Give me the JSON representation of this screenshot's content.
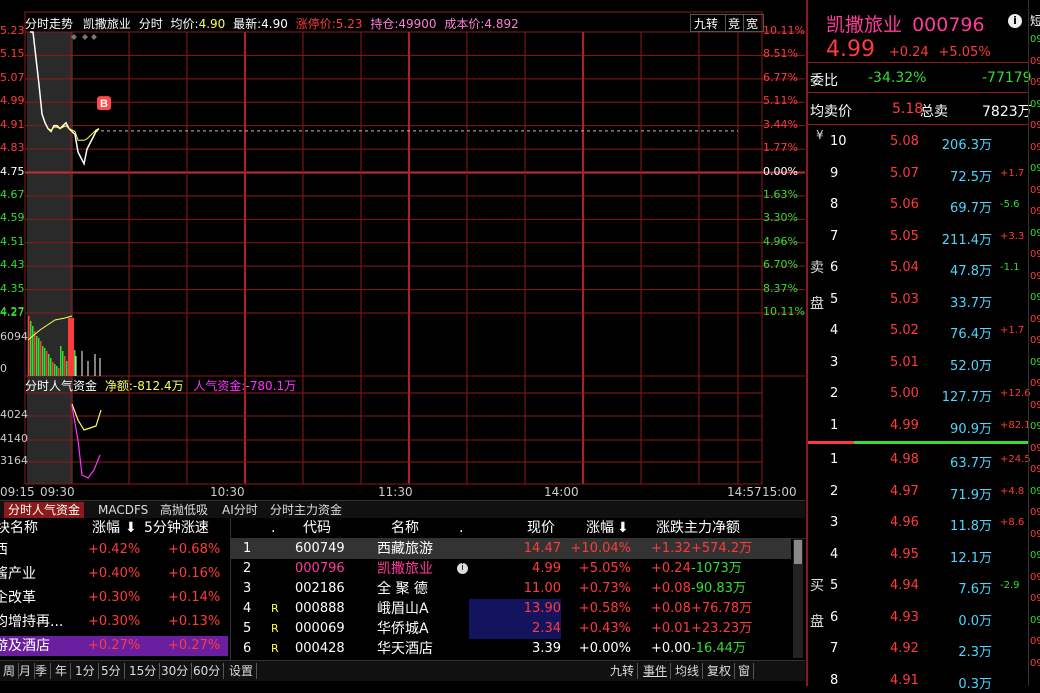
{
  "header": {
    "title": "分时走势",
    "stock_name": "凯撒旅业",
    "mode": "分时",
    "avg_label": "均价:",
    "avg": "4.90",
    "last_label": "最新:",
    "last": "4.90",
    "limit_label": "涨停价:",
    "limit": "5.23",
    "pos_label": "持仓:",
    "pos": "49900",
    "cost_label": "成本价:",
    "cost": "4.892",
    "btn1": "九转",
    "btn2": "竞",
    "btn3": "宽"
  },
  "colors": {
    "grid": "#8b1a1a",
    "up": "#ff3b3b",
    "down": "#33dd33",
    "price_line": "#ffffff",
    "avg_line": "#ffff4d"
  },
  "chart_data": {
    "type": "line",
    "title": "分时走势",
    "x_ticks": [
      "09:15",
      "09:30",
      "10:30",
      "11:30",
      "14:00",
      "14:57",
      "15:00"
    ],
    "price_ticks": [
      "5.23",
      "5.15",
      "5.07",
      "4.99",
      "4.91",
      "4.83",
      "4.75",
      "4.67",
      "4.59",
      "4.51",
      "4.43",
      "4.35",
      "4.27"
    ],
    "pct_ticks": [
      "10.11%",
      "8.51%",
      "6.77%",
      "5.11%",
      "3.44%",
      "1.77%",
      "0.00%",
      "1.63%",
      "3.30%",
      "4.96%",
      "6.70%",
      "8.37%",
      "10.11%"
    ],
    "ylim": [
      4.27,
      5.23
    ],
    "prev_close": 4.75,
    "price_series": [
      {
        "t": 0,
        "v": 5.23
      },
      {
        "t": 1,
        "v": 5.23
      },
      {
        "t": 2,
        "v": 5.14
      },
      {
        "t": 3,
        "v": 5.05
      },
      {
        "t": 4,
        "v": 4.95
      },
      {
        "t": 5,
        "v": 4.92
      },
      {
        "t": 6,
        "v": 4.9
      },
      {
        "t": 7,
        "v": 4.89
      },
      {
        "t": 8,
        "v": 4.91
      },
      {
        "t": 9,
        "v": 4.91
      },
      {
        "t": 10,
        "v": 4.9
      },
      {
        "t": 11,
        "v": 4.91
      },
      {
        "t": 12,
        "v": 4.92
      },
      {
        "t": 13,
        "v": 4.9
      },
      {
        "t": 14,
        "v": 4.89
      },
      {
        "t": 15,
        "v": 4.88
      },
      {
        "t": 16,
        "v": 4.82
      },
      {
        "t": 17,
        "v": 4.8
      },
      {
        "t": 18,
        "v": 4.78
      },
      {
        "t": 19,
        "v": 4.83
      },
      {
        "t": 20,
        "v": 4.85
      },
      {
        "t": 21,
        "v": 4.87
      },
      {
        "t": 22,
        "v": 4.89
      },
      {
        "t": 23,
        "v": 4.9
      }
    ],
    "buy_marker": {
      "label": "B",
      "t": 22
    },
    "cost_line": 4.892,
    "volume_ticks": [
      "4.27",
      "6094",
      "0"
    ],
    "flow_title": "分时人气资金",
    "net_label": "净额:",
    "net": "-812.4万",
    "pop_label": "人气资金:",
    "pop": "-780.1万",
    "flow_ticks": [
      "4024",
      "4140",
      "3164"
    ]
  },
  "tabs": [
    "分时人气资金",
    "MACDFS",
    "高抛低吸",
    "AI分时",
    "分时主力资金"
  ],
  "sector_table": {
    "headers": [
      "块名称",
      "涨幅",
      "5分钟涨速"
    ],
    "rows": [
      {
        "name": "西",
        "chg": "+0.42%",
        "speed": "+0.68%"
      },
      {
        "name": "酱产业",
        "chg": "+0.40%",
        "speed": "+0.16%"
      },
      {
        "name": "企改革",
        "chg": "+0.30%",
        "speed": "+0.14%"
      },
      {
        "name": "均增持再...",
        "chg": "+0.30%",
        "speed": "+0.13%"
      },
      {
        "name": "游及酒店",
        "chg": "+0.27%",
        "speed": "+0.27%"
      }
    ]
  },
  "stock_table": {
    "headers": [
      ".",
      "代码",
      "名称",
      ".",
      "现价",
      "涨幅",
      "涨跌主力净额"
    ],
    "rows": [
      {
        "idx": "1",
        "flag": "",
        "code": "600749",
        "name": "西藏旅游",
        "price": "14.47",
        "chg": "+10.04%",
        "diff": "+1.32",
        "net": "+574.2万"
      },
      {
        "idx": "2",
        "flag": "",
        "code": "000796",
        "name": "凯撒旅业",
        "price": "4.99",
        "chg": "+5.05%",
        "diff": "+0.24",
        "net": "-1073万"
      },
      {
        "idx": "3",
        "flag": "",
        "code": "002186",
        "name": "全 聚 德",
        "price": "11.00",
        "chg": "+0.73%",
        "diff": "+0.08",
        "net": "-90.83万"
      },
      {
        "idx": "4",
        "flag": "R",
        "code": "000888",
        "name": "峨眉山A",
        "price": "13.90",
        "chg": "+0.58%",
        "diff": "+0.08",
        "net": "+76.78万"
      },
      {
        "idx": "5",
        "flag": "R",
        "code": "000069",
        "name": "华侨城A",
        "price": "2.34",
        "chg": "+0.43%",
        "diff": "+0.01",
        "net": "+23.23万"
      },
      {
        "idx": "6",
        "flag": "R",
        "code": "000428",
        "name": "华天酒店",
        "price": "3.39",
        "chg": "+0.00%",
        "diff": "+0.00",
        "net": "-16.44万"
      }
    ]
  },
  "bottom_bar": [
    "周",
    "月",
    "季",
    "年",
    "1分",
    "5分",
    "15分",
    "30分",
    "60分",
    "设置"
  ],
  "bottom_right": [
    "九转",
    "事件",
    "均线",
    "复权",
    "窗"
  ],
  "quote": {
    "name": "凯撒旅业",
    "code": "000796",
    "price": "4.99",
    "change": "+0.24",
    "pct": "+5.05%",
    "weibi_label": "委比",
    "weibi": "-34.32%",
    "weicha": "-77179",
    "avg_sell_label": "均卖价",
    "avg_sell": "5.18",
    "total_sell_label": "总卖",
    "total_sell": "7823万",
    "sell_label_1": "卖",
    "sell_label_2": "盘",
    "buy_label_1": "买",
    "buy_label_2": "盘",
    "sell_levels": [
      {
        "level": "10",
        "price": "5.08",
        "vol": "206.3万",
        "delta": ""
      },
      {
        "level": "9",
        "price": "5.07",
        "vol": "72.5万",
        "delta": "+1.7"
      },
      {
        "level": "8",
        "price": "5.06",
        "vol": "69.7万",
        "delta": "-5.6"
      },
      {
        "level": "7",
        "price": "5.05",
        "vol": "211.4万",
        "delta": "+3.3"
      },
      {
        "level": "6",
        "price": "5.04",
        "vol": "47.8万",
        "delta": "-1.1"
      },
      {
        "level": "5",
        "price": "5.03",
        "vol": "33.7万",
        "delta": ""
      },
      {
        "level": "4",
        "price": "5.02",
        "vol": "76.4万",
        "delta": "+1.7"
      },
      {
        "level": "3",
        "price": "5.01",
        "vol": "52.0万",
        "delta": ""
      },
      {
        "level": "2",
        "price": "5.00",
        "vol": "127.7万",
        "delta": "+12.6"
      },
      {
        "level": "1",
        "price": "4.99",
        "vol": "90.9万",
        "delta": "+82.1"
      }
    ],
    "buy_levels": [
      {
        "level": "1",
        "price": "4.98",
        "vol": "63.7万",
        "delta": "+24.5"
      },
      {
        "level": "2",
        "price": "4.97",
        "vol": "71.9万",
        "delta": "+4.8"
      },
      {
        "level": "3",
        "price": "4.96",
        "vol": "11.8万",
        "delta": "+8.6"
      },
      {
        "level": "4",
        "price": "4.95",
        "vol": "12.1万",
        "delta": ""
      },
      {
        "level": "5",
        "price": "4.94",
        "vol": "7.6万",
        "delta": "-2.9"
      },
      {
        "level": "6",
        "price": "4.93",
        "vol": "0.0万",
        "delta": ""
      },
      {
        "level": "7",
        "price": "4.92",
        "vol": "2.3万",
        "delta": ""
      },
      {
        "level": "8",
        "price": "4.91",
        "vol": "0.3万",
        "delta": ""
      }
    ]
  },
  "far_right": {
    "title": "短",
    "items": [
      "09",
      "09",
      "09",
      "09",
      "09",
      "09",
      "09",
      "09",
      "09",
      "09",
      "09",
      "09",
      "09",
      "09",
      "09",
      "09",
      "09",
      "09",
      "09",
      "09",
      "09",
      "09",
      "09",
      "09",
      "09",
      "09",
      "09",
      "09",
      "09",
      "09"
    ]
  }
}
